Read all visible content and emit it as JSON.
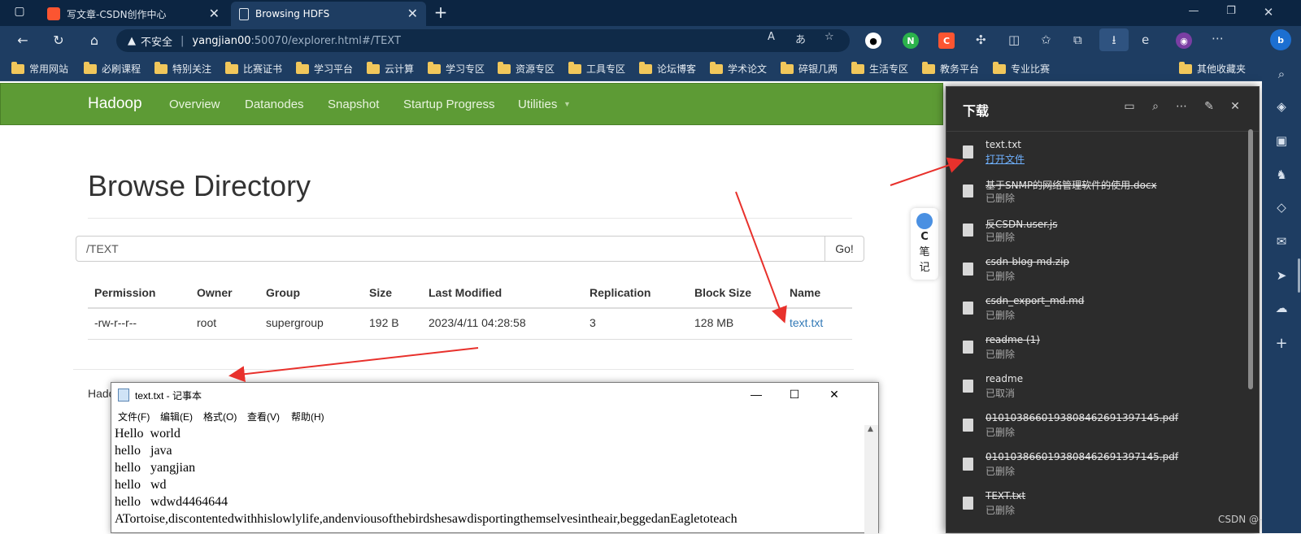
{
  "browser": {
    "tabs": [
      {
        "label": "写文章-CSDN创作中心"
      },
      {
        "label": "Browsing HDFS"
      }
    ],
    "address": {
      "warning": "不安全",
      "host": "yangjian00",
      "rest": ":50070/explorer.html#/TEXT"
    },
    "bookmarks": [
      "常用网站",
      "必刷课程",
      "特别关注",
      "比赛证书",
      "学习平台",
      "云计算",
      "学习专区",
      "资源专区",
      "工具专区",
      "论坛博客",
      "学术论文",
      "碎银几两",
      "生活专区",
      "教务平台",
      "专业比赛",
      "其他收藏夹"
    ]
  },
  "hadoop": {
    "brand": "Hadoop",
    "nav": [
      "Overview",
      "Datanodes",
      "Snapshot",
      "Startup Progress",
      "Utilities"
    ],
    "title": "Browse Directory",
    "path": "/TEXT",
    "go": "Go!",
    "columns": [
      "Permission",
      "Owner",
      "Group",
      "Size",
      "Last Modified",
      "Replication",
      "Block Size",
      "Name"
    ],
    "rows": [
      [
        "-rw-r--r--",
        "root",
        "supergroup",
        "192 B",
        "2023/4/11 04:28:58",
        "3",
        "128 MB",
        "text.txt"
      ]
    ],
    "footer": "Hado"
  },
  "notepad": {
    "title": "text.txt - 记事本",
    "menu": [
      "文件(F)",
      "编辑(E)",
      "格式(O)",
      "查看(V)",
      "帮助(H)"
    ],
    "text": "Hello  world\nhello   java\nhello   yangjian\nhello   wd\nhello   wdwd4464644\nATortoise,discontentedwithhislowlylife,andenviousofthebirdshesawdisportingthemselvesintheair,beggedanEagletoteach"
  },
  "side_note": {
    "c": "C",
    "a": "笔",
    "b": "记"
  },
  "downloads": {
    "title": "下载",
    "items": [
      {
        "name": "text.txt",
        "status": "打开文件",
        "deleted": false
      },
      {
        "name": "基于SNMP的网络管理软件的使用.docx",
        "status": "已删除",
        "deleted": true
      },
      {
        "name": "反CSDN.user.js",
        "status": "已删除",
        "deleted": true
      },
      {
        "name": "csdn-blog-md.zip",
        "status": "已删除",
        "deleted": true
      },
      {
        "name": "csdn_export_md.md",
        "status": "已删除",
        "deleted": true
      },
      {
        "name": "readme (1)",
        "status": "已删除",
        "deleted": true
      },
      {
        "name": "readme",
        "status": "已取消",
        "deleted": false
      },
      {
        "name": "01010386601938084626913971​45.pdf",
        "status": "已删除",
        "deleted": true
      },
      {
        "name": "0101038660193808462691397145.pdf",
        "status": "已删除",
        "deleted": true
      },
      {
        "name": "TEXT.txt",
        "status": "已删除",
        "deleted": true
      }
    ]
  },
  "watermark": "CSDN @-牧心-",
  "colors": {
    "hadoop_green": "#5d9b35",
    "link": "#337ab7",
    "browser_dark": "#1e3d62",
    "arrow_red": "#e8312c"
  }
}
